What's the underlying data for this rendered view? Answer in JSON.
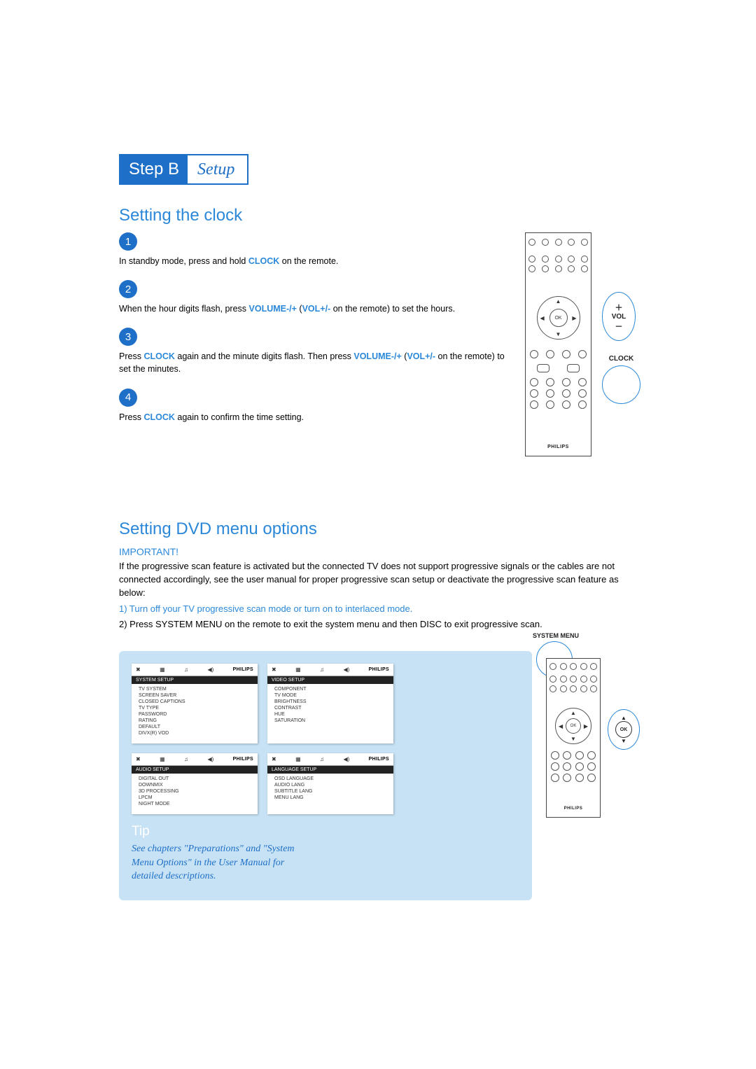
{
  "header": {
    "step_label": "Step B",
    "setup_label": "Setup"
  },
  "section1": {
    "title": "Setting the clock",
    "steps": [
      {
        "num": "1",
        "parts": [
          "In standby mode, press and hold ",
          "CLOCK",
          " on the remote."
        ]
      },
      {
        "num": "2",
        "parts": [
          "When the hour digits flash, press ",
          "VOLUME-/+",
          " (",
          "VOL+/-",
          " on the remote) to set the hours."
        ]
      },
      {
        "num": "3",
        "parts": [
          "Press ",
          "CLOCK",
          " again and the minute digits flash. Then press ",
          "VOLUME-/+",
          " (",
          "VOL+/-",
          " on the remote) to set the minutes."
        ]
      },
      {
        "num": "4",
        "parts": [
          "Press ",
          "CLOCK",
          " again to confirm the time setting."
        ]
      }
    ]
  },
  "remote": {
    "ok_label": "OK",
    "brand": "PHILIPS",
    "vol_label": "VOL",
    "clock_label": "CLOCK",
    "sysmenu_label": "SYSTEM MENU"
  },
  "section2": {
    "title": "Setting DVD menu options",
    "important": "IMPORTANT!",
    "p1": "If the progressive scan feature is activated but the connected TV does not support progressive signals or the cables are not connected accordingly, see the user manual for proper progressive scan setup or deactivate the progressive scan feature as below:",
    "p2": "1) Turn off your TV progressive scan mode or turn on to interlaced mode.",
    "p3": "2) Press SYSTEM MENU on the remote to exit the system menu and then DISC to exit progressive scan."
  },
  "menus": {
    "system": {
      "title": "SYSTEM SETUP",
      "items": [
        "TV SYSTEM",
        "SCREEN SAVER",
        "CLOSED CAPTIONS",
        "TV TYPE",
        "PASSWORD",
        "RATING",
        "DEFAULT",
        "DIVX(R) VOD"
      ]
    },
    "video": {
      "title": "VIDEO SETUP",
      "items": [
        "COMPONENT",
        "TV MODE",
        "BRIGHTNESS",
        "CONTRAST",
        "HUE",
        "SATURATION"
      ]
    },
    "audio": {
      "title": "AUDIO SETUP",
      "items": [
        "DIGITAL OUT",
        "DOWNMIX",
        "3D PROCESSING",
        "LPCM",
        "NIGHT MODE"
      ]
    },
    "language": {
      "title": "LANGUAGE SETUP",
      "items": [
        "OSD LANGUAGE",
        "AUDIO LANG",
        "SUBTITLE LANG",
        "MENU LANG"
      ]
    },
    "tabs_brand": "PHILIPS"
  },
  "tip": {
    "title": "Tip",
    "body": "See chapters \"Preparations\" and \"System Menu Options\" in the User Manual for detailed descriptions."
  }
}
